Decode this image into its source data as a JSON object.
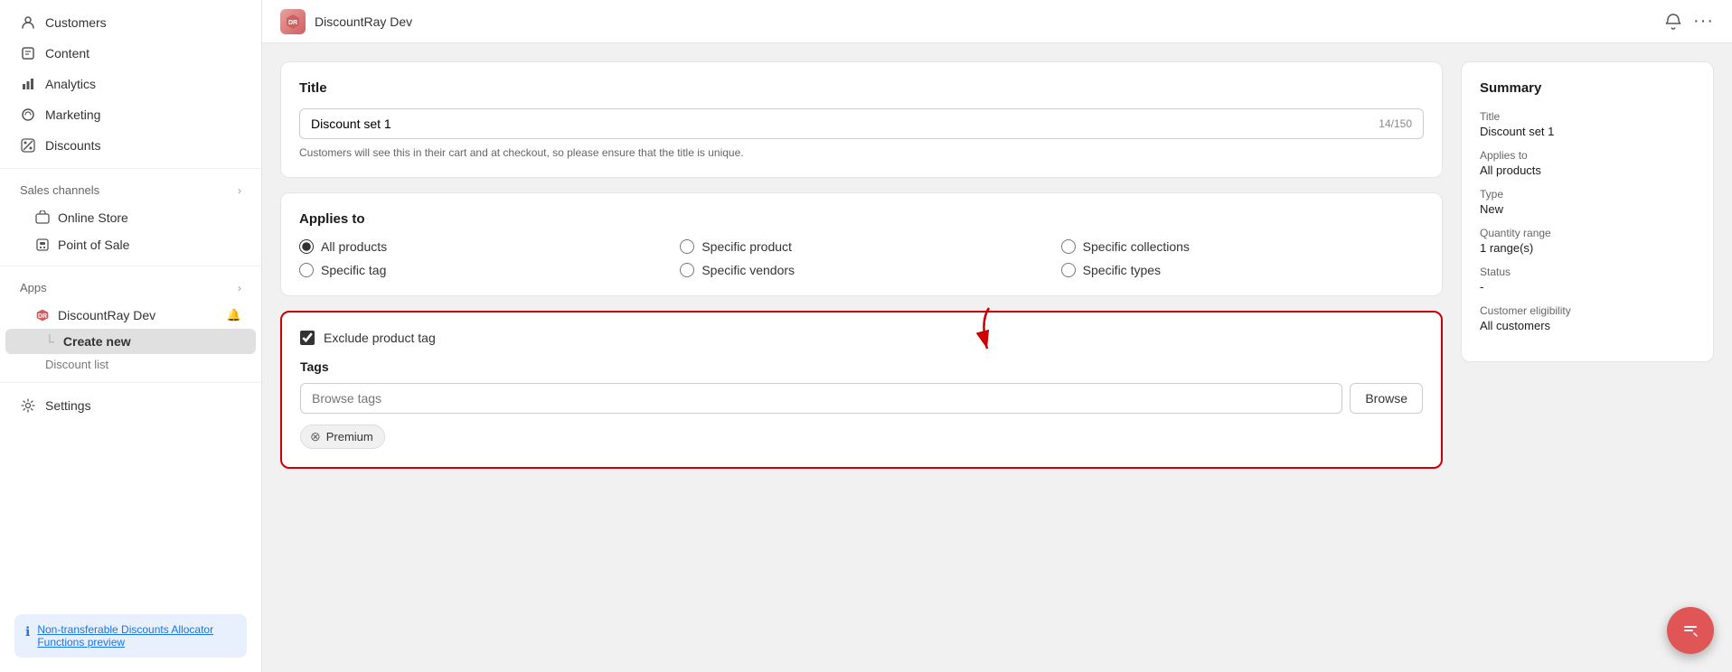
{
  "sidebar": {
    "nav_items": [
      {
        "id": "customers",
        "label": "Customers",
        "icon": "👤"
      },
      {
        "id": "content",
        "label": "Content",
        "icon": "📄"
      },
      {
        "id": "analytics",
        "label": "Analytics",
        "icon": "📊"
      },
      {
        "id": "marketing",
        "label": "Marketing",
        "icon": "🔄"
      },
      {
        "id": "discounts",
        "label": "Discounts",
        "icon": "🏷️"
      }
    ],
    "sales_channels_label": "Sales channels",
    "sales_channels": [
      {
        "id": "online-store",
        "label": "Online Store",
        "icon": "🏪"
      },
      {
        "id": "point-of-sale",
        "label": "Point of Sale",
        "icon": "🏦"
      }
    ],
    "apps_label": "Apps",
    "apps": [
      {
        "id": "discountray",
        "label": "DiscountRay Dev",
        "icon": "⬡",
        "bell": true
      }
    ],
    "create_new_label": "Create new",
    "discount_list_label": "Discount list",
    "settings_label": "Settings",
    "non_transferable_text": "Non-transferable Discounts Allocator Functions preview"
  },
  "topbar": {
    "logo_text": "DR",
    "title": "DiscountRay Dev",
    "bell_icon": "🔔",
    "more_icon": "···"
  },
  "title_card": {
    "heading": "Title",
    "input_value": "Discount set 1",
    "char_count": "14/150",
    "helper_text": "Customers will see this in their cart and at checkout, so please ensure that the title is unique."
  },
  "applies_to_card": {
    "heading": "Applies to",
    "options": [
      {
        "id": "all-products",
        "label": "All products",
        "checked": true
      },
      {
        "id": "specific-product",
        "label": "Specific product",
        "checked": false
      },
      {
        "id": "specific-collections",
        "label": "Specific collections",
        "checked": false
      },
      {
        "id": "specific-tag",
        "label": "Specific tag",
        "checked": false
      },
      {
        "id": "specific-vendors",
        "label": "Specific vendors",
        "checked": false
      },
      {
        "id": "specific-types",
        "label": "Specific types",
        "checked": false
      }
    ]
  },
  "exclude_card": {
    "checkbox_label": "Exclude product tag",
    "checkbox_checked": true,
    "tags_heading": "Tags",
    "browse_placeholder": "Browse tags",
    "browse_button": "Browse",
    "tags": [
      {
        "label": "Premium"
      }
    ]
  },
  "summary": {
    "heading": "Summary",
    "rows": [
      {
        "label": "Title",
        "value": "Discount set 1"
      },
      {
        "label": "Applies to",
        "value": "All products"
      },
      {
        "label": "Type",
        "value": "New"
      },
      {
        "label": "Quantity range",
        "value": "1 range(s)"
      },
      {
        "label": "Status",
        "value": "-"
      },
      {
        "label": "Customer eligibility",
        "value": "All customers"
      }
    ]
  }
}
